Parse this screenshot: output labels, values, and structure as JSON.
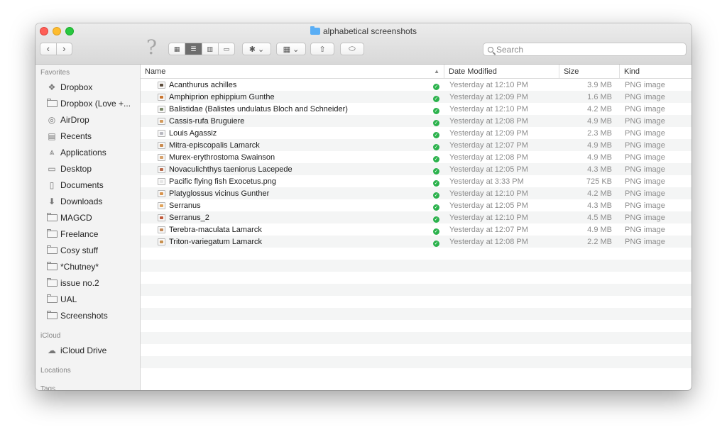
{
  "window": {
    "title": "alphabetical screenshots"
  },
  "toolbar": {
    "back_glyph": "‹",
    "forward_glyph": "›",
    "help_glyph": "?",
    "view_icons": "▦",
    "view_list": "☰",
    "view_columns": "▥",
    "view_gallery": "▭",
    "action_glyph": "✱ ⌄",
    "arrange_glyph": "▦ ⌄",
    "share_glyph": "⇧",
    "tag_glyph": "⬭"
  },
  "search": {
    "placeholder": "Search"
  },
  "sidebar": {
    "favorites_header": "Favorites",
    "favorites": [
      {
        "label": "Dropbox",
        "icon": "dropbox-icon"
      },
      {
        "label": "Dropbox (Love +...",
        "icon": "folder-icon"
      },
      {
        "label": "AirDrop",
        "icon": "airdrop-icon"
      },
      {
        "label": "Recents",
        "icon": "recents-icon"
      },
      {
        "label": "Applications",
        "icon": "applications-icon"
      },
      {
        "label": "Desktop",
        "icon": "desktop-icon"
      },
      {
        "label": "Documents",
        "icon": "documents-icon"
      },
      {
        "label": "Downloads",
        "icon": "downloads-icon"
      },
      {
        "label": "MAGCD",
        "icon": "folder-icon"
      },
      {
        "label": "Freelance",
        "icon": "folder-icon"
      },
      {
        "label": "Cosy stuff",
        "icon": "folder-icon"
      },
      {
        "label": "*Chutney*",
        "icon": "folder-icon"
      },
      {
        "label": "issue no.2",
        "icon": "folder-icon"
      },
      {
        "label": "UAL",
        "icon": "folder-icon"
      },
      {
        "label": "Screenshots",
        "icon": "folder-icon"
      }
    ],
    "icloud_header": "iCloud",
    "icloud": [
      {
        "label": "iCloud Drive",
        "icon": "cloud-icon"
      }
    ],
    "locations_header": "Locations",
    "tags_header": "Tags"
  },
  "columns": {
    "name": "Name",
    "date": "Date Modified",
    "size": "Size",
    "kind": "Kind"
  },
  "files": [
    {
      "name": "Acanthurus achilles",
      "date": "Yesterday at 12:10 PM",
      "size": "3.9 MB",
      "kind": "PNG image",
      "thumb_color": "#5a4a3a"
    },
    {
      "name": "Amphiprion ephippium Gunthe",
      "date": "Yesterday at 12:09 PM",
      "size": "1.6 MB",
      "kind": "PNG image",
      "thumb_color": "#c8742e"
    },
    {
      "name": "Balistidae (Balistes undulatus Bloch and Schneider)",
      "date": "Yesterday at 12:10 PM",
      "size": "4.2 MB",
      "kind": "PNG image",
      "thumb_color": "#7c8a6a"
    },
    {
      "name": "Cassis-rufa Bruguiere",
      "date": "Yesterday at 12:08 PM",
      "size": "4.9 MB",
      "kind": "PNG image",
      "thumb_color": "#d29a5c"
    },
    {
      "name": "Louis Agassiz",
      "date": "Yesterday at 12:09 PM",
      "size": "2.3 MB",
      "kind": "PNG image",
      "thumb_color": "#b8b8c0"
    },
    {
      "name": "Mitra-episcopalis Lamarck",
      "date": "Yesterday at 12:07 PM",
      "size": "4.9 MB",
      "kind": "PNG image",
      "thumb_color": "#c98a4e"
    },
    {
      "name": "Murex-erythrostoma Swainson",
      "date": "Yesterday at 12:08 PM",
      "size": "4.9 MB",
      "kind": "PNG image",
      "thumb_color": "#d6a06a"
    },
    {
      "name": "Novaculichthys taeniorus Lacepede",
      "date": "Yesterday at 12:05 PM",
      "size": "4.3 MB",
      "kind": "PNG image",
      "thumb_color": "#b86a4a"
    },
    {
      "name": "Pacific flying fish Exocetus.png",
      "date": "Yesterday at 3:33 PM",
      "size": "725 KB",
      "kind": "PNG image",
      "thumb_color": "#e6e6e6"
    },
    {
      "name": "Platyglossus vicinus Gunther",
      "date": "Yesterday at 12:10 PM",
      "size": "4.2 MB",
      "kind": "PNG image",
      "thumb_color": "#d8944e"
    },
    {
      "name": "Serranus",
      "date": "Yesterday at 12:05 PM",
      "size": "4.3 MB",
      "kind": "PNG image",
      "thumb_color": "#e0a35a"
    },
    {
      "name": "Serranus_2",
      "date": "Yesterday at 12:10 PM",
      "size": "4.5 MB",
      "kind": "PNG image",
      "thumb_color": "#c05a3a"
    },
    {
      "name": "Terebra-maculata Lamarck",
      "date": "Yesterday at 12:07 PM",
      "size": "4.9 MB",
      "kind": "PNG image",
      "thumb_color": "#c48a5a"
    },
    {
      "name": "Triton-variegatum Lamarck",
      "date": "Yesterday at 12:08 PM",
      "size": "2.2 MB",
      "kind": "PNG image",
      "thumb_color": "#c7904e"
    }
  ],
  "colors": {
    "sync_ok": "#2bb24c",
    "title_folder": "#5aaef5"
  }
}
